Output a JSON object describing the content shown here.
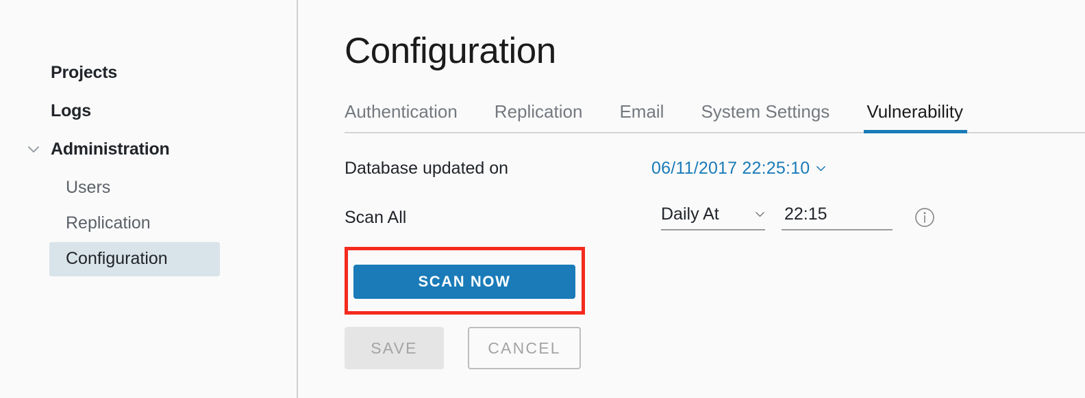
{
  "sidebar": {
    "items": [
      {
        "label": "Projects",
        "level": "top",
        "expandable": false,
        "active": false
      },
      {
        "label": "Logs",
        "level": "top",
        "expandable": false,
        "active": false
      },
      {
        "label": "Administration",
        "level": "top",
        "expandable": true,
        "icon": "chevron-down-icon",
        "active": false
      },
      {
        "label": "Users",
        "level": "sub",
        "expandable": false,
        "active": false
      },
      {
        "label": "Replication",
        "level": "sub",
        "expandable": false,
        "active": false
      },
      {
        "label": "Configuration",
        "level": "sub",
        "expandable": false,
        "active": true
      }
    ]
  },
  "main": {
    "title": "Configuration",
    "tabs": [
      {
        "label": "Authentication",
        "active": false
      },
      {
        "label": "Replication",
        "active": false
      },
      {
        "label": "Email",
        "active": false
      },
      {
        "label": "System Settings",
        "active": false
      },
      {
        "label": "Vulnerability",
        "active": true
      }
    ],
    "database_row": {
      "label": "Database updated on",
      "value": "06/11/2017 22:25:10",
      "caret_icon": "chevron-down-icon"
    },
    "scan_row": {
      "label": "Scan All",
      "schedule_value": "Daily At",
      "schedule_caret_icon": "chevron-down-icon",
      "time_value": "22:15",
      "time_placeholder": "HH:MM",
      "info_icon": "info-circle-icon"
    },
    "scan_now_label": "SCAN NOW",
    "save_label": "SAVE",
    "cancel_label": "CANCEL"
  },
  "colors": {
    "accent_blue": "#1a7bb8",
    "highlight_red": "#f42a1e",
    "sidebar_active_bg": "#d9e4ea",
    "page_bg": "#fafafa",
    "muted_text": "#74797f"
  }
}
